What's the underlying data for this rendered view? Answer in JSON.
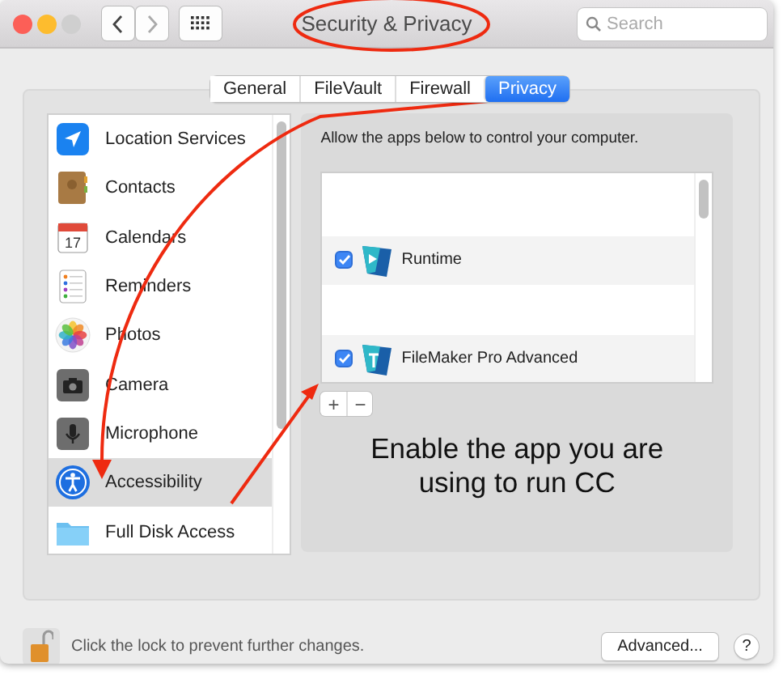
{
  "window": {
    "title": "Security & Privacy"
  },
  "search": {
    "placeholder": "Search"
  },
  "tabs": [
    {
      "label": "General",
      "selected": false
    },
    {
      "label": "FileVault",
      "selected": false
    },
    {
      "label": "Firewall",
      "selected": false
    },
    {
      "label": "Privacy",
      "selected": true
    }
  ],
  "sidebar": {
    "items": [
      {
        "label": "Location Services",
        "selected": false
      },
      {
        "label": "Contacts",
        "selected": false
      },
      {
        "label": "Calendars",
        "selected": false
      },
      {
        "label": "Reminders",
        "selected": false
      },
      {
        "label": "Photos",
        "selected": false
      },
      {
        "label": "Camera",
        "selected": false
      },
      {
        "label": "Microphone",
        "selected": false
      },
      {
        "label": "Accessibility",
        "selected": true
      },
      {
        "label": "Full Disk Access",
        "selected": false
      }
    ]
  },
  "calendar_day": "17",
  "description": "Allow the apps below to control your computer.",
  "apps": [
    {
      "kind": "blank"
    },
    {
      "kind": "app",
      "name": "Runtime",
      "checked": true
    },
    {
      "kind": "blank"
    },
    {
      "kind": "app",
      "name": "FileMaker Pro Advanced",
      "checked": true
    }
  ],
  "list_buttons": [
    "+",
    "−"
  ],
  "note": "Enable the app you are using to run CC",
  "lock_text": "Click the lock to prevent further changes.",
  "advanced_button": "Advanced...",
  "help_button": "?"
}
